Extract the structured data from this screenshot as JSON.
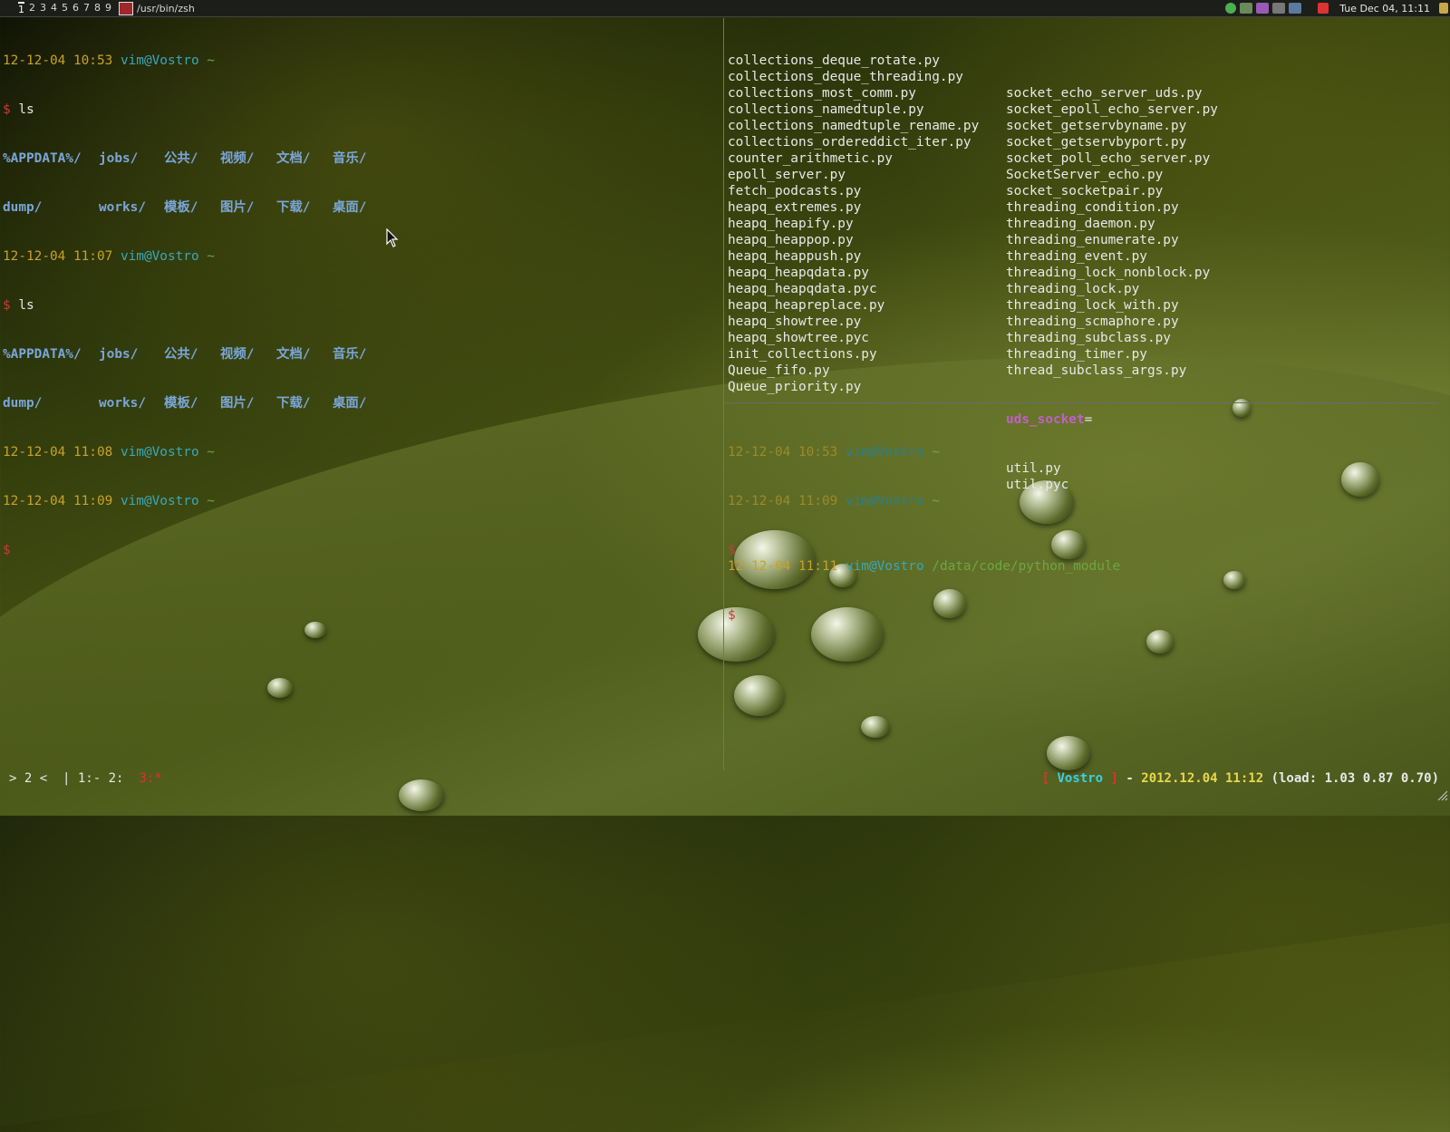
{
  "topbar": {
    "workspaces": [
      "1",
      "2",
      "3",
      "4",
      "5",
      "6",
      "7",
      "8",
      "9"
    ],
    "active_workspace": "1",
    "window_title": "/usr/bin/zsh",
    "clock": "Tue Dec 04, 11:11"
  },
  "left_pane": {
    "prompts": [
      {
        "ts": "12-12-04 10:53",
        "host": "vim@Vostro",
        "path": "~"
      },
      {
        "ts": "12-12-04 11:07",
        "host": "vim@Vostro",
        "path": "~"
      },
      {
        "ts": "12-12-04 11:08",
        "host": "vim@Vostro",
        "path": "~"
      },
      {
        "ts": "12-12-04 11:09",
        "host": "vim@Vostro",
        "path": "~"
      }
    ],
    "dollar": "$",
    "cmd1": "ls",
    "cmd2": "ls",
    "ls_row1": [
      "%APPDATA%/",
      "jobs/",
      "公共/",
      "视频/",
      "文档/",
      "音乐/"
    ],
    "ls_row2": [
      "dump/",
      "works/",
      "模板/",
      "图片/",
      "下载/",
      "桌面/"
    ]
  },
  "right_pane": {
    "col1": [
      "collections_deque_rotate.py",
      "collections_deque_threading.py",
      "collections_most_comm.py",
      "collections_namedtuple.py",
      "collections_namedtuple_rename.py",
      "collections_ordereddict_iter.py",
      "counter_arithmetic.py",
      "epoll_server.py",
      "fetch_podcasts.py",
      "heapq_extremes.py",
      "heapq_heapify.py",
      "heapq_heappop.py",
      "heapq_heappush.py",
      "heapq_heapqdata.py",
      "heapq_heapqdata.pyc",
      "heapq_heapreplace.py",
      "heapq_showtree.py",
      "heapq_showtree.pyc",
      "init_collections.py",
      "Queue_fifo.py",
      "Queue_priority.py"
    ],
    "col2": [
      "socket_echo_server_uds.py",
      "socket_epoll_echo_server.py",
      "socket_getservbyname.py",
      "socket_getservbyport.py",
      "socket_poll_echo_server.py",
      "SocketServer_echo.py",
      "socket_socketpair.py",
      "threading_condition.py",
      "threading_daemon.py",
      "threading_enumerate.py",
      "threading_event.py",
      "threading_lock_nonblock.py",
      "threading_lock.py",
      "threading_lock_with.py",
      "threading_scmaphore.py",
      "threading_subclass.py",
      "threading_timer.py",
      "thread_subclass_args.py"
    ],
    "uds_socket": "uds_socket",
    "uds_suffix": "=",
    "col2_tail": [
      "util.py",
      "util.pyc"
    ],
    "prompt": {
      "ts": "12-12-04 11:11",
      "host": "vim@Vostro",
      "path": "/data/code/python_module"
    },
    "dollar": "$"
  },
  "bottom_pane": {
    "prompts": [
      {
        "ts": "12-12-04 10:53",
        "host": "vim@Vostro",
        "path": "~"
      },
      {
        "ts": "12-12-04 11:09",
        "host": "vim@Vostro",
        "path": "~"
      }
    ],
    "dollar": "$"
  },
  "statusbar": {
    "left_session": "> 2 <",
    "left_windows": "| 1:- 2:",
    "left_current": "3:*",
    "bracket_open": "[",
    "hostname": "Vostro",
    "bracket_close": "]",
    "dash": "-",
    "datetime": "2012.12.04 11:12",
    "load": "(load: 1.03 0.87 0.70)"
  },
  "colors": {
    "timestamp": "#c9a227",
    "host": "#3aa7b7",
    "path": "#6fa640",
    "prompt": "#c93a3a",
    "directory": "#7aa6d8",
    "socket": "#c060c8"
  }
}
